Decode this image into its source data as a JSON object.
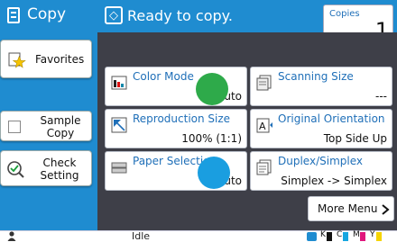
{
  "header": {
    "app_title": "Copy",
    "status": "Ready to copy.",
    "copies_label": "Copies",
    "copies_value": "1"
  },
  "sidebar": {
    "favorites": "Favorites",
    "sample_copy": "Sample\nCopy",
    "check_setting": "Check\nSetting"
  },
  "functions": {
    "color_mode": {
      "label": "Color Mode",
      "value": "Auto"
    },
    "scanning_size": {
      "label": "Scanning Size",
      "value": "---"
    },
    "reproduction_size": {
      "label": "Reproduction Size",
      "value": "100% (1:1)"
    },
    "original_orientation": {
      "label": "Original Orientation",
      "value": "Top Side Up"
    },
    "paper_selection": {
      "label": "Paper Selection",
      "value": "Auto"
    },
    "duplex_simplex": {
      "label": "Duplex/Simplex",
      "value": "Simplex -> Simplex"
    }
  },
  "more_menu": "More Menu",
  "footer": {
    "status": "Idle",
    "ink": [
      "K",
      "C",
      "M",
      "Y"
    ]
  },
  "colors": {
    "accent": "#1f8cd0",
    "main_bg": "#3e3f48",
    "marker_green": "#2eaa4a",
    "marker_blue": "#1a9ee0"
  }
}
